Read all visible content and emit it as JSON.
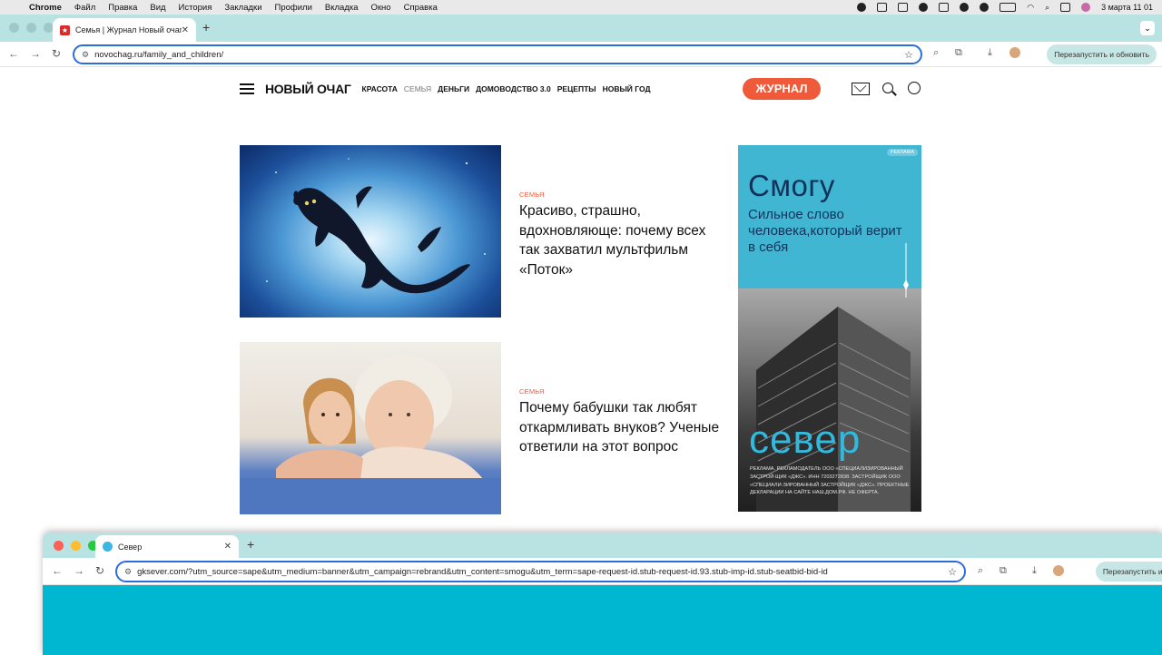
{
  "menubar": {
    "app": "Chrome",
    "items": [
      "Файл",
      "Правка",
      "Вид",
      "История",
      "Закладки",
      "Профили",
      "Вкладка",
      "Окно",
      "Справка"
    ],
    "clock": "3 марта  11 01"
  },
  "browser1": {
    "tab_title": "Семья | Журнал Новый очаг",
    "url": "novochag.ru/family_and_children/",
    "relaunch": "Перезапустить и обновить"
  },
  "site": {
    "logo": "НОВЫЙ ОЧАГ",
    "nav": [
      "КРАСОТА",
      "СЕМЬЯ",
      "ДЕНЬГИ",
      "ДОМОВОДСТВО 3.0",
      "РЕЦЕПТЫ",
      "НОВЫЙ ГОД"
    ],
    "journal_button": "ЖУРНАЛ"
  },
  "articles": [
    {
      "category": "СЕМЬЯ",
      "title": "Красиво, страшно, вдохновляюще: почему всех так захватил мультфильм «Поток»"
    },
    {
      "category": "СЕМЬЯ",
      "title": "Почему бабушки так любят откармливать внуков? Ученые ответили на этот вопрос"
    }
  ],
  "ad": {
    "badge": "РЕКЛАМА",
    "headline": "Смогу",
    "subline": "Сильное слово человека,который верит в себя",
    "brand": "север",
    "legal": "Реклама. Рекламодатель ООО «Специализированный застрой-щик «ДЖС». ИНН 7203272838. Застройщик ООО «Специали-зированный застройщик «ДЖС». Проектные декларации на сайте наш.дом.рф. Не оферта."
  },
  "browser2": {
    "tab_title": "Север",
    "url": "gksever.com/?utm_source=sape&utm_medium=banner&utm_campaign=rebrand&utm_content=smogu&utm_term=sape-request-id.stub-request-id.93.stub-imp-id.stub-seatbid-bid-id",
    "relaunch": "Перезапустить и обно"
  },
  "colors": {
    "accent": "#ee5a3a",
    "tabstrip": "#b9e3e2",
    "ad_blue": "#41b6d3",
    "landing_cyan": "#00b7d1"
  }
}
